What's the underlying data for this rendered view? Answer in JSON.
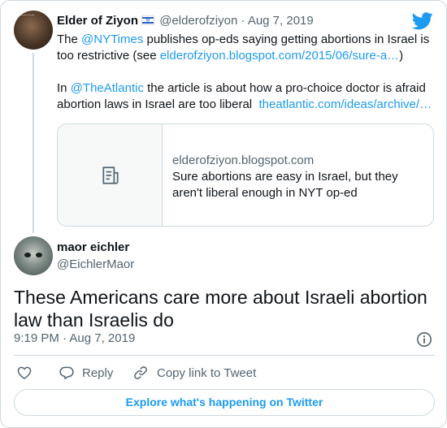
{
  "quoted_tweet": {
    "author_name": "Elder of Ziyon",
    "author_flag": "israel-flag",
    "handle": "@elderofziyon",
    "separator": "·",
    "date": "Aug 7, 2019",
    "line1": {
      "pre": "The ",
      "mention": "@NYTimes",
      "post": " publishes op-eds saying getting abortions in Israel is"
    },
    "line2": {
      "pre": "too restrictive (see ",
      "link": "elderofziyon.blogspot.com/2015/06/sure-a…",
      "post": ")"
    },
    "line3": {
      "pre": "In ",
      "mention": "@TheAtlantic",
      "post": " the article is about how a pro-choice doctor is afraid"
    },
    "line4": {
      "pre": "abortion laws in Israel are too liberal  ",
      "link": "theatlantic.com/ideas/archive/…"
    },
    "link_card": {
      "domain": "elderofziyon.blogspot.com",
      "title": "Sure abortions are easy in Israel, but they aren't liberal enough in NYT op-ed",
      "icon": "document-icon"
    }
  },
  "tweet": {
    "author_name": "maor eichler",
    "handle": "@EichlerMaor",
    "text": "These Americans care more about Israeli abortion law than Israelis do",
    "time": "9:19 PM",
    "separator": "·",
    "date": "Aug 7, 2019"
  },
  "actions": {
    "like_icon": "heart-icon",
    "reply_label": "Reply",
    "copy_label": "Copy link to Tweet"
  },
  "footer": {
    "explore_label": "Explore what's happening on Twitter"
  },
  "colors": {
    "accent": "#1d9bf0",
    "text": "#0f1419",
    "muted": "#536471",
    "border": "#cfd9de"
  }
}
